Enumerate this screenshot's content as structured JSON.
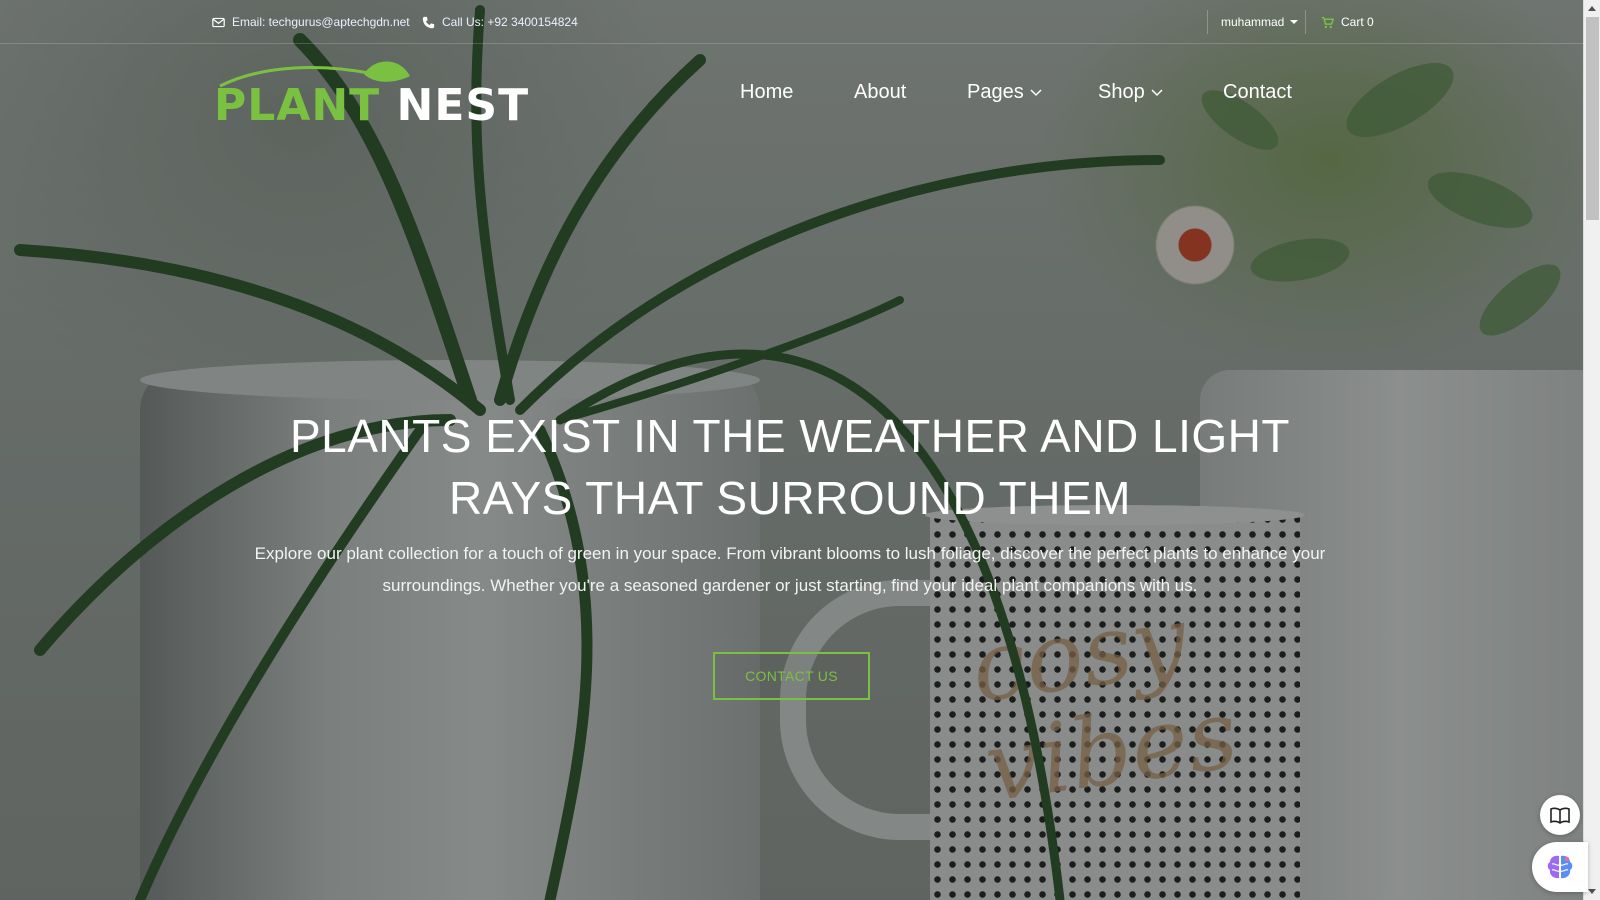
{
  "topbar": {
    "email": "Email: techgurus@aptechgdn.net",
    "phone": "Call Us: +92 3400154824",
    "user": "muhammad",
    "cart": "Cart 0"
  },
  "logo": {
    "part1": "PLANT",
    "part2": "NEST"
  },
  "nav": {
    "home": "Home",
    "about": "About",
    "pages": "Pages",
    "shop": "Shop",
    "contact": "Contact"
  },
  "hero": {
    "title": "PLANTS EXIST IN THE WEATHER AND LIGHT RAYS THAT SURROUND THEM",
    "text": "Explore our plant collection for a touch of green in your space. From vibrant blooms to lush foliage, discover the perfect plants to enhance your surroundings. Whether you're a seasoned gardener or just starting, find your ideal plant companions with us.",
    "cta": "CONTACT US"
  },
  "background": {
    "mug_text": "cosy vibes"
  },
  "colors": {
    "brand_green": "#7ac142",
    "overlay": "#141816"
  },
  "icons": {
    "email": "envelope-icon",
    "phone": "phone-icon",
    "cart": "cart-icon",
    "dropdown": "chevron-down-icon",
    "reader": "book-icon",
    "ai": "brain-icon"
  }
}
